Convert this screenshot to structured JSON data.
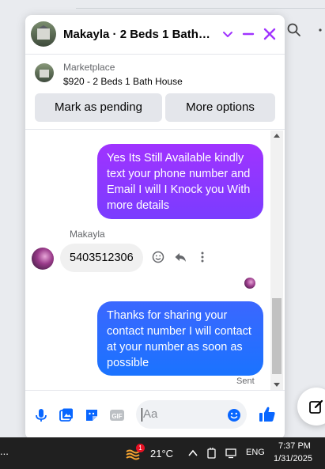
{
  "chat": {
    "title": "Makayla · 2 Beds 1 Bath H...",
    "accent": "#a033ff"
  },
  "marketplace": {
    "label": "Marketplace",
    "item": "$920 - 2 Beds 1 Bath House",
    "pending_button": "Mark as pending",
    "options_button": "More options"
  },
  "messages": {
    "outgoing_1": "Yes Its Still Available kindly text your phone number and Email I will I Knock you With more details",
    "sender_name": "Makayla",
    "incoming_1": "5403512306",
    "outgoing_2": "Thanks for sharing your contact number I will contact at your number as soon as possible",
    "status": "Sent"
  },
  "composer": {
    "placeholder": "Aa"
  },
  "taskbar": {
    "overflow": "...",
    "weather_badge": "1",
    "temperature": "21°C",
    "language": "ENG",
    "time": "7:37 PM",
    "date": "1/31/2025"
  }
}
